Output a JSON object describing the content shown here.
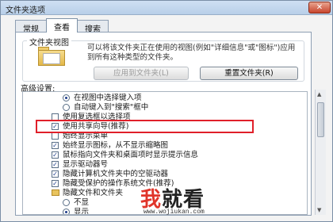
{
  "window": {
    "title": "文件夹选项",
    "close_label": "✕"
  },
  "tabs": [
    {
      "label": "常规",
      "active": false
    },
    {
      "label": "查看",
      "active": true
    },
    {
      "label": "搜索",
      "active": false
    }
  ],
  "folder_views": {
    "group_label": "文件夹视图",
    "description": "可以将该文件夹正在使用的视图(例如\"详细信息\"或\"图标\")应用到所有这种类型的文件夹。",
    "apply_button": "应用到文件夹(L)",
    "reset_button": "重置文件夹(R)"
  },
  "advanced": {
    "label": "高级设置:",
    "items": [
      {
        "kind": "radio",
        "checked": true,
        "label": "在视图中选择键入项"
      },
      {
        "kind": "radio",
        "checked": false,
        "label": "自动键入到\"搜索\"框中"
      },
      {
        "kind": "checkbox",
        "checked": false,
        "label": "使用复选框以选择项"
      },
      {
        "kind": "checkbox",
        "checked": true,
        "label": "使用共享向导(推荐)"
      },
      {
        "kind": "checkbox",
        "checked": false,
        "label": "始终显示菜单"
      },
      {
        "kind": "checkbox",
        "checked": true,
        "label": "始终显示图标，从不显示缩略图"
      },
      {
        "kind": "checkbox",
        "checked": true,
        "label": "鼠标指向文件夹和桌面项时显示提示信息"
      },
      {
        "kind": "checkbox",
        "checked": true,
        "label": "显示驱动器号"
      },
      {
        "kind": "checkbox",
        "checked": true,
        "label": "隐藏计算机文件夹中的空驱动器"
      },
      {
        "kind": "checkbox",
        "checked": true,
        "label": "隐藏受保护的操作系统文件(推荐)"
      },
      {
        "kind": "folder",
        "checked": false,
        "label": "隐藏文件和文件夹"
      },
      {
        "kind": "radio",
        "checked": false,
        "label": "不显"
      },
      {
        "kind": "radio",
        "checked": true,
        "label": "显示"
      }
    ]
  },
  "watermark": {
    "main_red": "我",
    "main_rest": "就看",
    "sub": "www.wojiukan.com"
  },
  "colors": {
    "highlight_border": "#e0202a",
    "watermark_red": "#e0352a"
  }
}
